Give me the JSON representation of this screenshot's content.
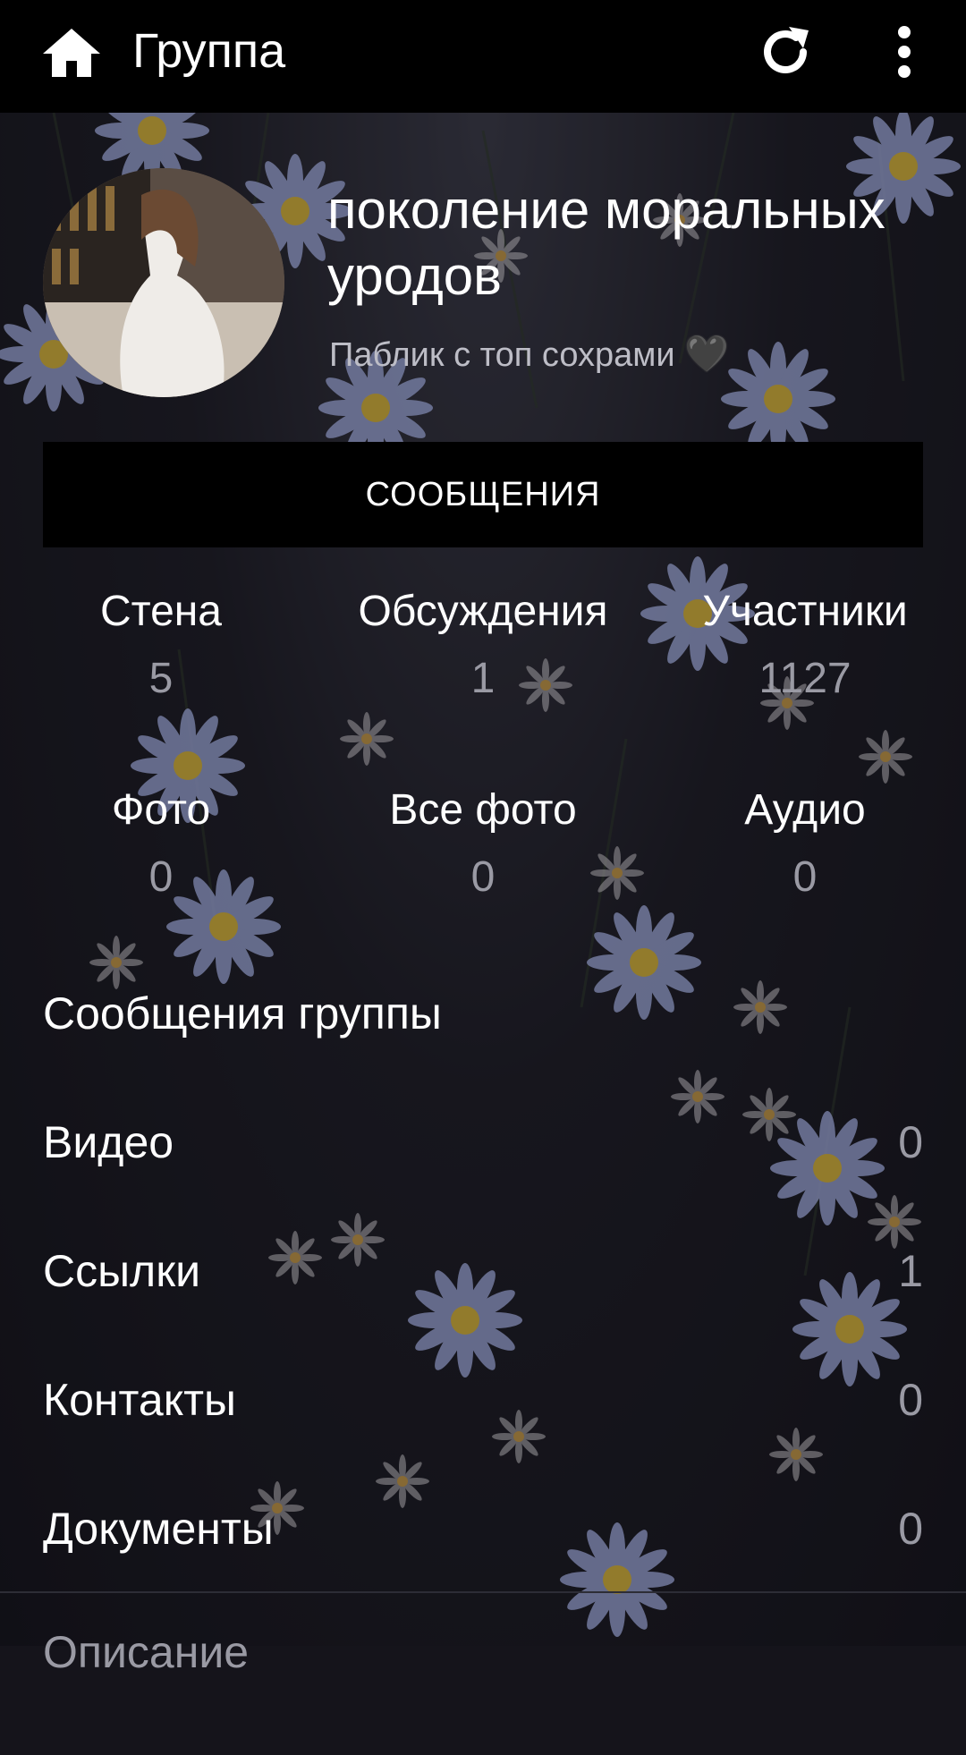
{
  "appbar": {
    "title": "Группа",
    "icons": {
      "home": "home-icon",
      "refresh": "refresh-icon",
      "more": "more-vertical-icon"
    }
  },
  "group": {
    "name": "поколение моральных уродов",
    "status": "Паблик с топ сохрами",
    "status_emoji": "🖤"
  },
  "messages_button": {
    "label": "СООБЩЕНИЯ"
  },
  "counters": [
    {
      "label": "Стена",
      "value": "5"
    },
    {
      "label": "Обсуждения",
      "value": "1"
    },
    {
      "label": "Участники",
      "value": "1127"
    },
    {
      "label": "Фото",
      "value": "0"
    },
    {
      "label": "Все фото",
      "value": "0"
    },
    {
      "label": "Аудио",
      "value": "0"
    }
  ],
  "list": [
    {
      "label": "Сообщения группы",
      "count": ""
    },
    {
      "label": "Видео",
      "count": "0"
    },
    {
      "label": "Ссылки",
      "count": "1"
    },
    {
      "label": "Контакты",
      "count": "0"
    },
    {
      "label": "Документы",
      "count": "0"
    },
    {
      "label": "Описание",
      "count": ""
    }
  ],
  "colors": {
    "appbar": "#000000",
    "button": "#000000",
    "muted_text": "#9a9aa4",
    "flower_petal": "#a9b4e8",
    "flower_center": "#e2b83a"
  }
}
